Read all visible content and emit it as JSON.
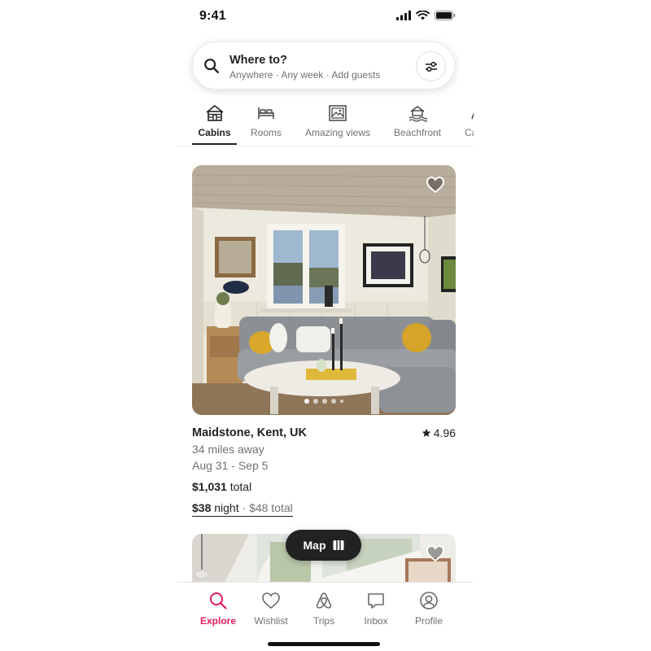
{
  "status_bar": {
    "time": "9:41"
  },
  "search": {
    "title": "Where to?",
    "subtitle": "Anywhere · Any week · Add guests"
  },
  "categories": [
    {
      "label": "Cabins",
      "icon": "cabin-icon",
      "active": true
    },
    {
      "label": "Rooms",
      "icon": "bed-icon",
      "active": false
    },
    {
      "label": "Amazing views",
      "icon": "framed-picture-icon",
      "active": false
    },
    {
      "label": "Beachfront",
      "icon": "beach-house-icon",
      "active": false
    },
    {
      "label": "Ca",
      "icon": "partial-category-icon",
      "active": false
    }
  ],
  "listing": {
    "location": "Maidstone, Kent, UK",
    "rating": "4.96",
    "distance": "34 miles away",
    "dates": "Aug 31 - Sep 5",
    "total_price": "$1,031",
    "total_label": "total",
    "night_price": "$38",
    "night_label": "night",
    "separator": "·",
    "fee_text": "$48 total",
    "photo_count": 5,
    "active_photo": 1
  },
  "map_button": {
    "label": "Map"
  },
  "bottom_nav": [
    {
      "label": "Explore",
      "icon": "search-icon",
      "active": true
    },
    {
      "label": "Wishlist",
      "icon": "heart-icon",
      "active": false
    },
    {
      "label": "Trips",
      "icon": "airbnb-logo-icon",
      "active": false
    },
    {
      "label": "Inbox",
      "icon": "message-icon",
      "active": false
    },
    {
      "label": "Profile",
      "icon": "profile-icon",
      "active": false
    }
  ],
  "colors": {
    "accent": "#E31C5F",
    "text": "#222222",
    "muted": "#717171"
  }
}
